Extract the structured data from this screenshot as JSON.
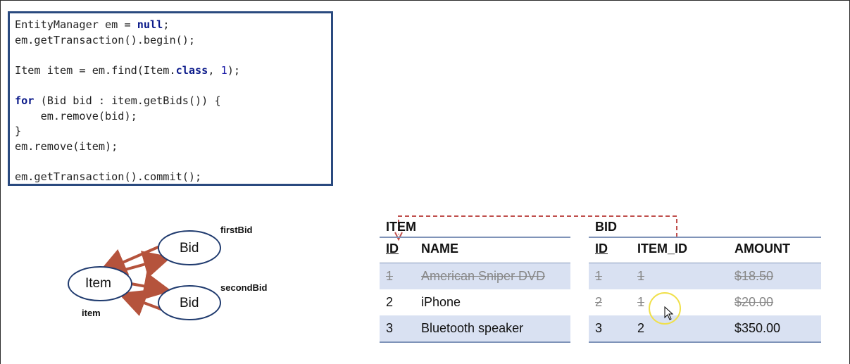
{
  "code": {
    "lines": [
      [
        {
          "t": "EntityManager em = "
        },
        {
          "t": "null",
          "k": "kw"
        },
        {
          "t": ";"
        }
      ],
      [
        {
          "t": "em.getTransaction().begin();"
        }
      ],
      [
        {
          "t": ""
        }
      ],
      [
        {
          "t": "Item item = em.find(Item."
        },
        {
          "t": "class",
          "k": "kw"
        },
        {
          "t": ", "
        },
        {
          "t": "1",
          "k": "num"
        },
        {
          "t": ");"
        }
      ],
      [
        {
          "t": ""
        }
      ],
      [
        {
          "t": "for",
          "k": "kw"
        },
        {
          "t": " (Bid bid : item.getBids()) {"
        }
      ],
      [
        {
          "t": "    em.remove(bid);"
        }
      ],
      [
        {
          "t": "}"
        }
      ],
      [
        {
          "t": "em.remove(item);"
        }
      ],
      [
        {
          "t": ""
        }
      ],
      [
        {
          "t": "em.getTransaction().commit();"
        }
      ]
    ]
  },
  "diagram": {
    "item_node": "Item",
    "bid_node_1": "Bid",
    "bid_node_2": "Bid",
    "label_item": "item",
    "label_first_bid": "firstBid",
    "label_second_bid": "secondBid",
    "ellipse_stroke": "#1f3a6e",
    "arrow_color": "#b5533c"
  },
  "item_table": {
    "title": "ITEM",
    "headers": [
      "ID",
      "NAME"
    ],
    "rows": [
      {
        "id": "1",
        "name": "American Sniper DVD",
        "deleted": true
      },
      {
        "id": "2",
        "name": "iPhone",
        "deleted": false
      },
      {
        "id": "3",
        "name": "Bluetooth speaker",
        "deleted": false
      }
    ]
  },
  "bid_table": {
    "title": "BID",
    "headers": [
      "ID",
      "ITEM_ID",
      "AMOUNT"
    ],
    "rows": [
      {
        "id": "1",
        "item_id": "1",
        "amount": "$18.50",
        "deleted": true
      },
      {
        "id": "2",
        "item_id": "1",
        "amount": "$20.00",
        "deleted": true
      },
      {
        "id": "3",
        "item_id": "2",
        "amount": "$350.00",
        "deleted": false
      }
    ]
  },
  "colors": {
    "code_border": "#2a4a7f",
    "row_shade": "#d9e1f2",
    "fk_link": "#c0504d",
    "cursor_highlight": "#f0e04a"
  }
}
